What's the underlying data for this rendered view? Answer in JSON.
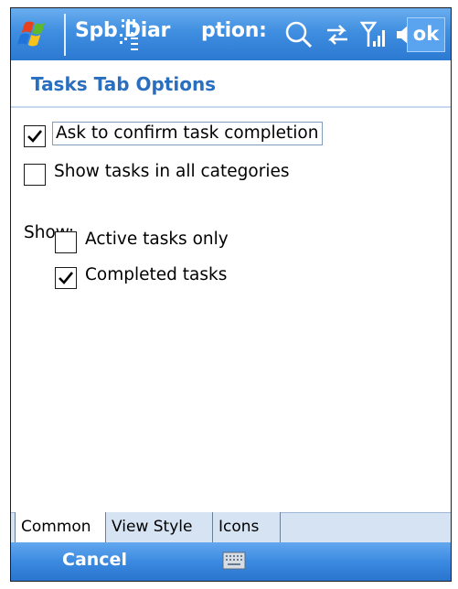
{
  "titlebar": {
    "title_part1": "Spb Diar",
    "title_part2": "ption:",
    "ok_label": "ok",
    "icons": [
      "windows-start-icon",
      "input-panel-overlay-icon",
      "search-icon",
      "connectivity-icon",
      "signal-strength-icon",
      "speaker-icon"
    ]
  },
  "header": {
    "title": "Tasks Tab Options"
  },
  "options": [
    {
      "label": "Ask to confirm task completion",
      "checked": true,
      "focused": true
    },
    {
      "label": "Show tasks in all categories",
      "checked": false,
      "focused": false
    }
  ],
  "show_group": {
    "label": "Show:",
    "items": [
      {
        "label": "Active tasks only",
        "checked": false
      },
      {
        "label": "Completed tasks",
        "checked": true
      }
    ]
  },
  "tabs": [
    {
      "label": "Common",
      "active": true
    },
    {
      "label": "View Style",
      "active": false
    },
    {
      "label": "Icons",
      "active": false
    }
  ],
  "menubar": {
    "left_softkey": "Cancel",
    "keyboard_icon": "keyboard-icon"
  },
  "colors": {
    "titlebar_blue": "#3f8ee0",
    "header_text": "#2a6fbf",
    "tabstrip_bg": "#d6e3f3"
  }
}
